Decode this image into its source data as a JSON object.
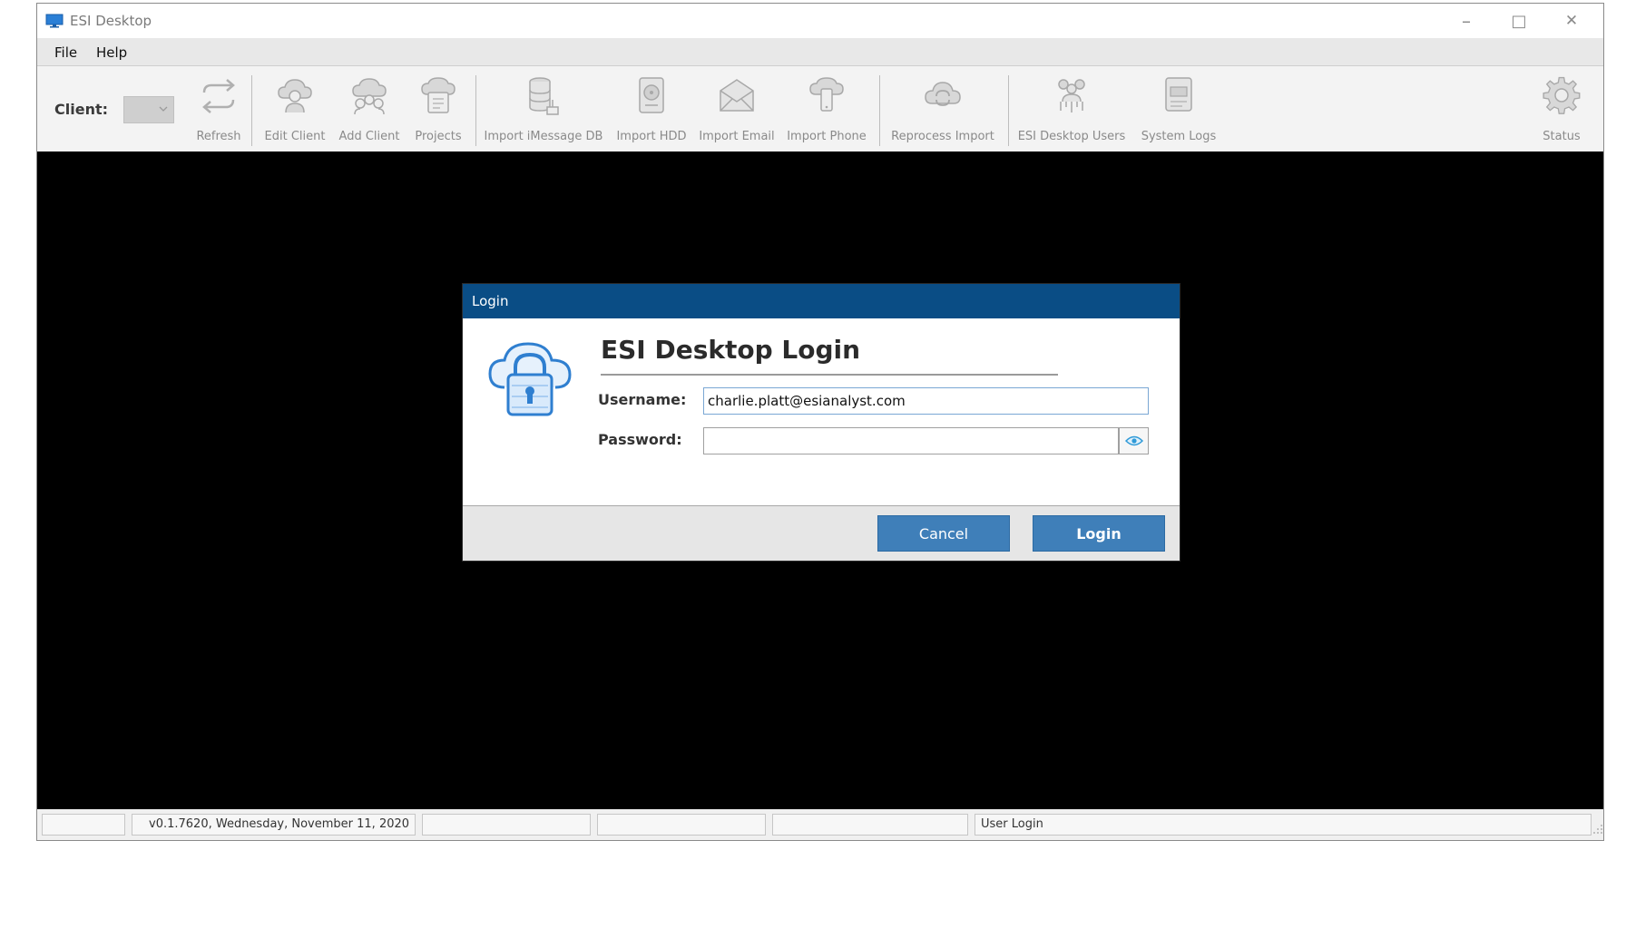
{
  "window": {
    "title": "ESI Desktop",
    "controls": {
      "minimize": "–",
      "maximize": "□",
      "close": "✕"
    }
  },
  "menu": [
    "File",
    "Help"
  ],
  "toolbar": {
    "client_label": "Client:",
    "buttons": [
      {
        "label": "Refresh",
        "icon": "refresh-icon"
      },
      {
        "label": "Edit Client",
        "icon": "edit-client-icon"
      },
      {
        "label": "Add Client",
        "icon": "add-client-icon"
      },
      {
        "label": "Projects",
        "icon": "projects-icon"
      },
      {
        "label": "Import iMessage DB",
        "icon": "database-icon"
      },
      {
        "label": "Import HDD",
        "icon": "hdd-icon"
      },
      {
        "label": "Import Email",
        "icon": "email-icon"
      },
      {
        "label": "Import Phone",
        "icon": "phone-icon"
      },
      {
        "label": "Reprocess Import",
        "icon": "reprocess-icon"
      },
      {
        "label": "ESI Desktop Users",
        "icon": "users-icon"
      },
      {
        "label": "System Logs",
        "icon": "logs-icon"
      },
      {
        "label": "Status",
        "icon": "gear-icon"
      }
    ]
  },
  "dialog": {
    "title": "Login",
    "heading": "ESI Desktop Login",
    "username_label": "Username:",
    "username_value": "charlie.platt@esianalyst.com",
    "password_label": "Password:",
    "password_value": "",
    "cancel_label": "Cancel",
    "login_label": "Login"
  },
  "status": {
    "version": "v0.1.7620, Wednesday, November 11, 2020",
    "message": "User Login"
  },
  "colors": {
    "dialog_title": "#0a4d85",
    "button": "#3f7fb9"
  }
}
